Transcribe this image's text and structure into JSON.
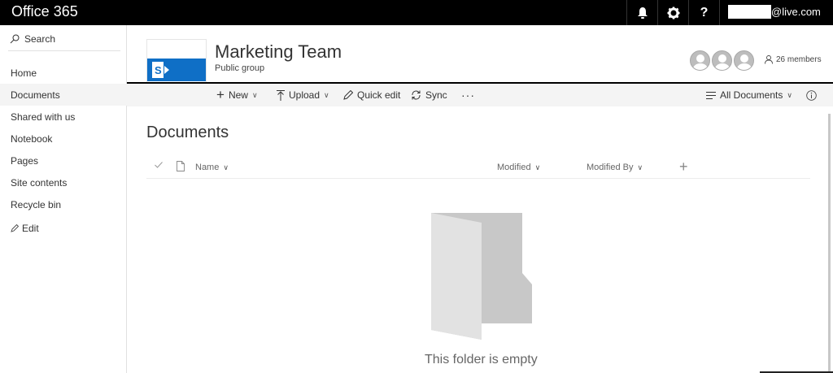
{
  "suitebar": {
    "app_title": "Office 365",
    "user_email_suffix": "@live.com",
    "icons": [
      "bell-icon",
      "gear-icon",
      "help-icon"
    ]
  },
  "leftnav": {
    "search_label": "Search",
    "items": [
      {
        "label": "Home"
      },
      {
        "label": "Documents"
      },
      {
        "label": "Shared with us"
      },
      {
        "label": "Notebook"
      },
      {
        "label": "Pages"
      },
      {
        "label": "Site contents"
      },
      {
        "label": "Recycle bin"
      },
      {
        "label": "Edit"
      }
    ],
    "selected_index": 1
  },
  "site": {
    "title": "Marketing Team",
    "subtitle": "Public group",
    "members_label": "26 members",
    "brand_color": "#0f6fc6"
  },
  "commandbar": {
    "new_label": "New",
    "upload_label": "Upload",
    "quick_edit_label": "Quick edit",
    "sync_label": "Sync",
    "more_label": "···",
    "view_label": "All Documents"
  },
  "library": {
    "title": "Documents",
    "columns": {
      "name": "Name",
      "modified": "Modified",
      "modified_by": "Modified By",
      "add": "+"
    },
    "empty_message": "This folder is empty"
  }
}
